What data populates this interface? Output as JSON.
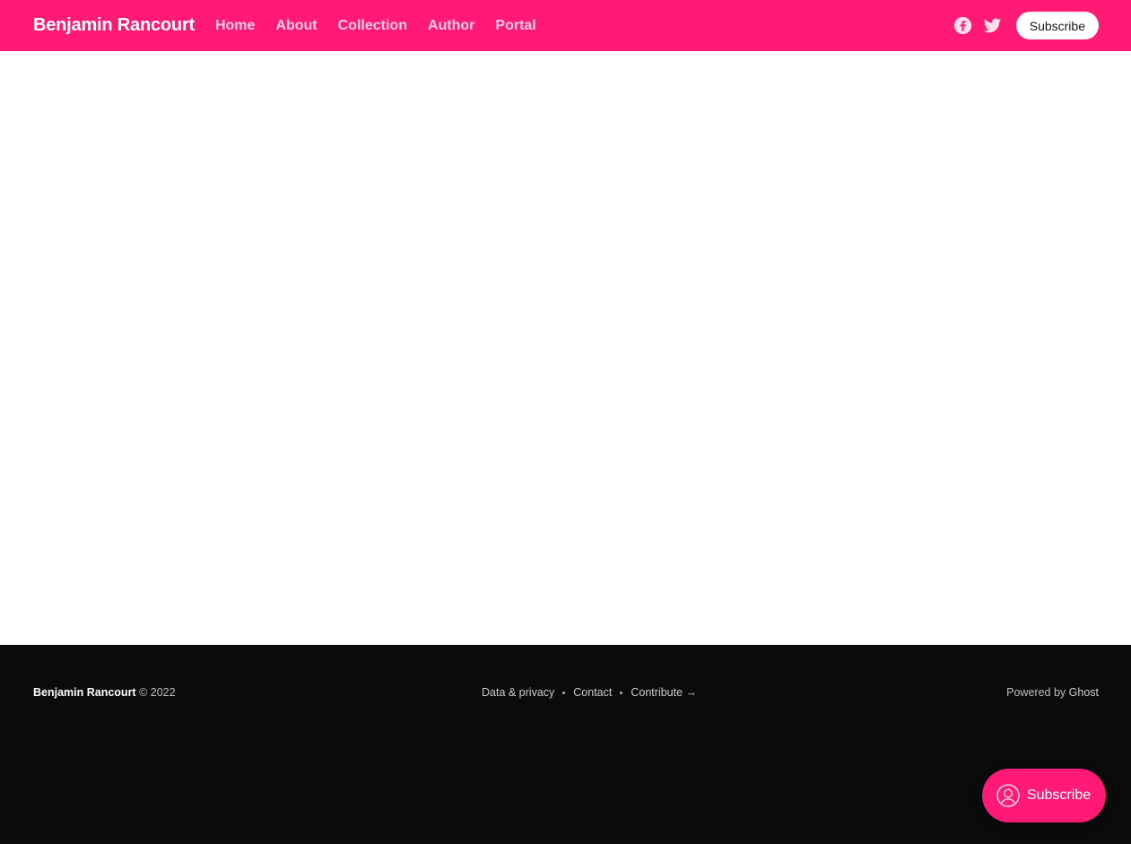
{
  "header": {
    "site_title": "Benjamin Rancourt",
    "nav": [
      {
        "label": "Home"
      },
      {
        "label": "About"
      },
      {
        "label": "Collection"
      },
      {
        "label": "Author"
      },
      {
        "label": "Portal"
      }
    ],
    "social_icons": [
      "facebook-icon",
      "twitter-icon"
    ],
    "subscribe_label": "Subscribe",
    "background_color": "#ff1a75"
  },
  "footer": {
    "copyright_name": "Benjamin Rancourt",
    "copyright_suffix": "© 2022",
    "links": [
      {
        "label": "Data & privacy"
      },
      {
        "label": "Contact"
      },
      {
        "label": "Contribute →"
      }
    ],
    "powered_prefix": "Powered by",
    "powered_link": "Ghost",
    "background_color": "#0a0b0d"
  },
  "portal": {
    "label": "Subscribe",
    "icon": "user-icon"
  }
}
